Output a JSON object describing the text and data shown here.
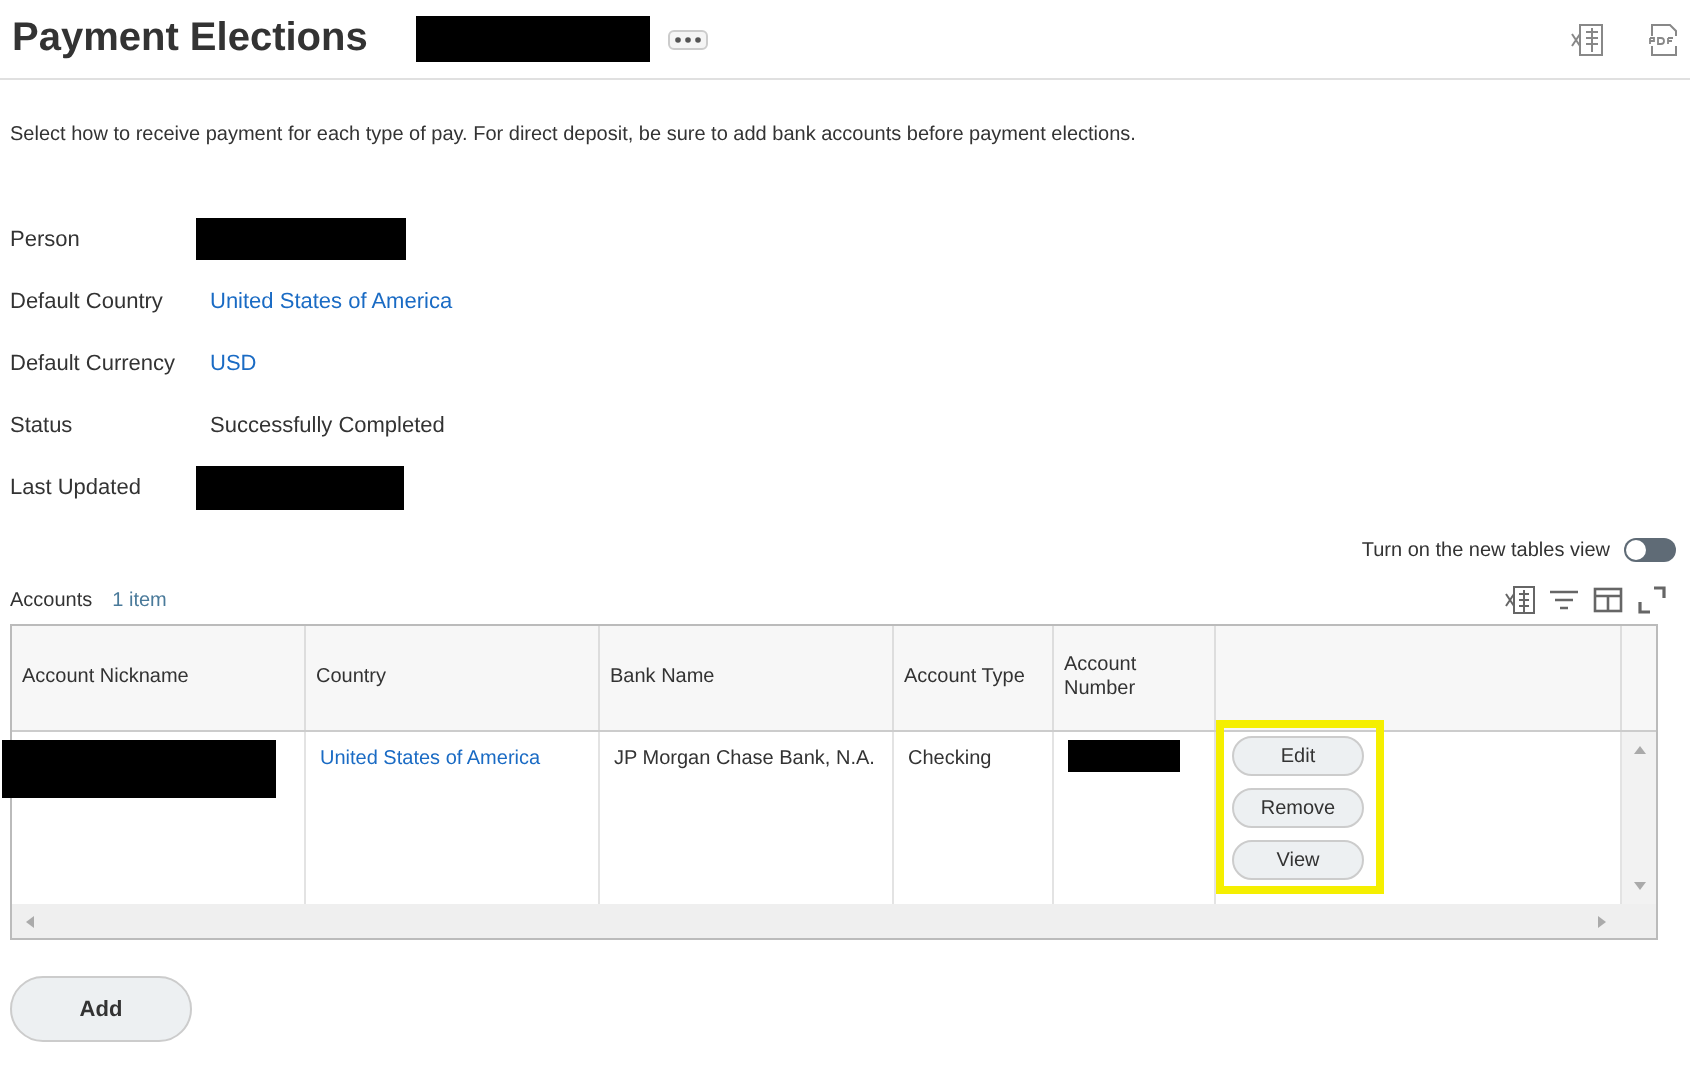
{
  "header": {
    "title": "Payment Elections"
  },
  "intro": "Select how to receive payment for each type of pay. For direct deposit, be sure to add bank accounts before payment elections.",
  "fields": [
    {
      "label": "Person",
      "kind": "redacted"
    },
    {
      "label": "Default Country",
      "kind": "link",
      "value": "United States of America"
    },
    {
      "label": "Default Currency",
      "kind": "link",
      "value": "USD"
    },
    {
      "label": "Status",
      "kind": "text",
      "value": "Successfully Completed"
    },
    {
      "label": "Last Updated",
      "kind": "redacted"
    }
  ],
  "toggle": {
    "label": "Turn on the new tables view",
    "on": false
  },
  "accounts": {
    "title": "Accounts",
    "count": "1 item",
    "columns": [
      "Account Nickname",
      "Country",
      "Bank Name",
      "Account Type",
      "Account Number"
    ],
    "rows": [
      {
        "cells": [
          {
            "kind": "redacted"
          },
          {
            "kind": "link",
            "value": "United States of America"
          },
          {
            "kind": "text",
            "value": "JP Morgan Chase Bank, N.A."
          },
          {
            "kind": "text",
            "value": "Checking"
          },
          {
            "kind": "redacted"
          }
        ],
        "actions": [
          "Edit",
          "Remove",
          "View"
        ],
        "highlighted": true
      }
    ]
  },
  "buttons": [
    "Add"
  ]
}
